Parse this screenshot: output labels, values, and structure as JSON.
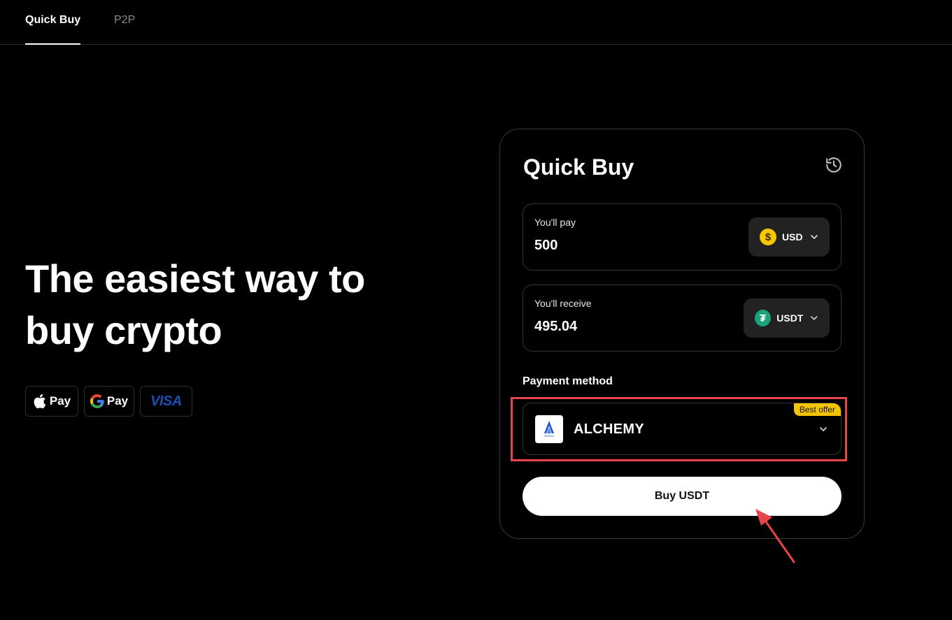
{
  "nav": {
    "tabs": [
      {
        "label": "Quick Buy",
        "active": true
      },
      {
        "label": "P2P",
        "active": false
      }
    ]
  },
  "hero": {
    "title_line1": "The easiest way to",
    "title_line2": "buy crypto",
    "payment_badges": {
      "apple": "Pay",
      "google": "Pay",
      "visa": "VISA"
    }
  },
  "card": {
    "title": "Quick Buy",
    "pay": {
      "label": "You'll pay",
      "value": "500",
      "currency": "USD",
      "currency_symbol": "$"
    },
    "receive": {
      "label": "You'll receive",
      "value": "495.04",
      "currency": "USDT",
      "currency_symbol": "₮"
    },
    "payment_method": {
      "label": "Payment method",
      "provider": "ALCHEMY",
      "badge": "Best offer"
    },
    "buy_button": "Buy USDT"
  },
  "colors": {
    "background": "#000000",
    "highlight": "#e8454a",
    "best_offer": "#f3c400",
    "usd_coin": "#f7c800",
    "usdt_coin": "#1ba27a"
  }
}
